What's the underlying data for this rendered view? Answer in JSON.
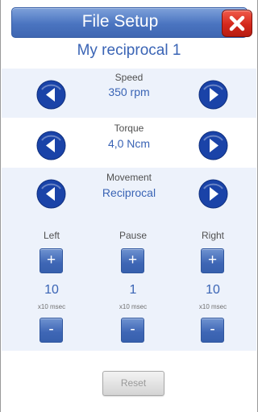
{
  "header": {
    "title": "File Setup"
  },
  "file": {
    "name": "My reciprocal 1"
  },
  "speed": {
    "label": "Speed",
    "value": "350 rpm"
  },
  "torque": {
    "label": "Torque",
    "value": "4,0 Ncm"
  },
  "movement": {
    "label": "Movement",
    "value": "Reciprocal"
  },
  "timing": {
    "left": {
      "label": "Left",
      "value": "10",
      "unit": "x10 msec"
    },
    "pause": {
      "label": "Pause",
      "value": "1",
      "unit": "x10 msec"
    },
    "right": {
      "label": "Right",
      "value": "10",
      "unit": "x10 msec"
    },
    "plus_label": "+",
    "minus_label": "-"
  },
  "reset": {
    "label": "Reset",
    "enabled": false
  },
  "colors": {
    "accent_blue": "#3a64b5",
    "band": "#edf2fb",
    "close_red": "#d4281c",
    "arrow_button": "#1a43a8"
  },
  "icons": {
    "close": "close-icon",
    "previous": "arrow-left-icon",
    "next": "arrow-right-icon"
  }
}
